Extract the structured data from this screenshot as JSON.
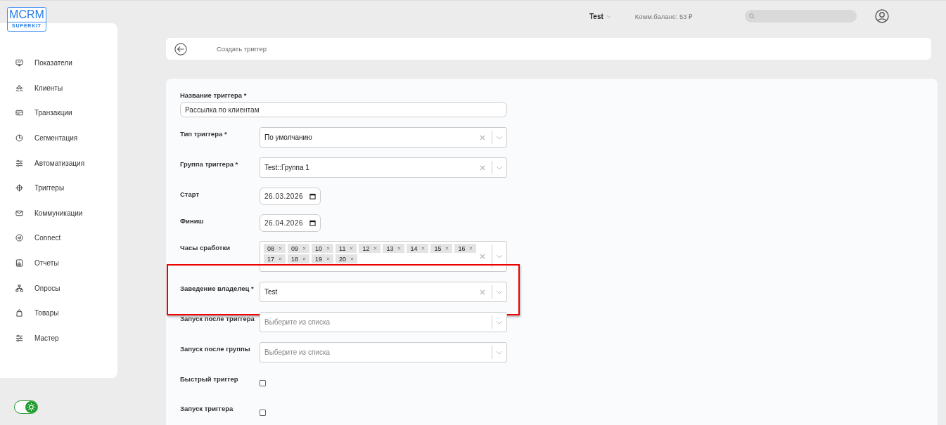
{
  "logo": {
    "title": "MCRM",
    "subtitle": "SUPERKIT"
  },
  "sidebar": {
    "items": [
      {
        "label": "Показатели"
      },
      {
        "label": "Клиенты"
      },
      {
        "label": "Транзакции"
      },
      {
        "label": "Сегментация"
      },
      {
        "label": "Автоматизация"
      },
      {
        "label": "Триггеры"
      },
      {
        "label": "Коммуникации"
      },
      {
        "label": "Connect"
      },
      {
        "label": "Отчеты"
      },
      {
        "label": "Опросы"
      },
      {
        "label": "Товары"
      },
      {
        "label": "Мастер"
      }
    ]
  },
  "theme_toggle": {
    "on": true
  },
  "header": {
    "account": "Test",
    "balance": "Комм.баланс: 53 ₽"
  },
  "breadcrumb": {
    "title": "Создать триггер"
  },
  "form": {
    "fields": [
      {
        "kind": "text",
        "label": "Название триггера *",
        "value": "Рассылка по клиентам"
      },
      {
        "kind": "select",
        "label": "Тип триггера *",
        "value": "По умолчанию",
        "clearable": true
      },
      {
        "kind": "select",
        "label": "Группа триггера *",
        "value": "Test::Группа 1",
        "clearable": true
      },
      {
        "kind": "date",
        "label": "Старт",
        "value": "26.03.2026"
      },
      {
        "kind": "date",
        "label": "Финиш",
        "value": "26.04.2026"
      },
      {
        "kind": "multiselect",
        "label": "Часы сработки",
        "tags": [
          "08",
          "09",
          "10",
          "11",
          "12",
          "13",
          "14",
          "15",
          "16",
          "17",
          "18",
          "19",
          "20"
        ]
      },
      {
        "kind": "select",
        "label": "Заведение владелец *",
        "value": "Test",
        "clearable": true,
        "highlighted": true
      },
      {
        "kind": "select",
        "label": "Запуск после триггера",
        "placeholder": "Выберите из списка",
        "clearable": false
      },
      {
        "kind": "select",
        "label": "Запуск после группы",
        "placeholder": "Выберите из списка",
        "clearable": false
      },
      {
        "kind": "checkbox",
        "label": "Быстрый триггер",
        "checked": false
      },
      {
        "kind": "checkbox",
        "label": "Запуск триггера",
        "checked": false
      }
    ]
  }
}
